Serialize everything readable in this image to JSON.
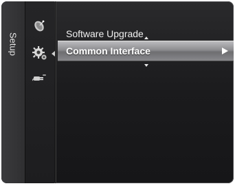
{
  "menu": {
    "category_title": "Setup",
    "categories": [
      {
        "icon": "satellite-dish-icon",
        "active": false
      },
      {
        "icon": "gear-icon",
        "active": true
      },
      {
        "icon": "plug-icon",
        "active": false
      }
    ],
    "items": [
      {
        "label": "Software Upgrade",
        "selected": false
      },
      {
        "label": "Common Interface",
        "selected": true
      }
    ],
    "colors": {
      "selected_bar": "#9a9a9d",
      "background": "#1f1f21"
    }
  }
}
